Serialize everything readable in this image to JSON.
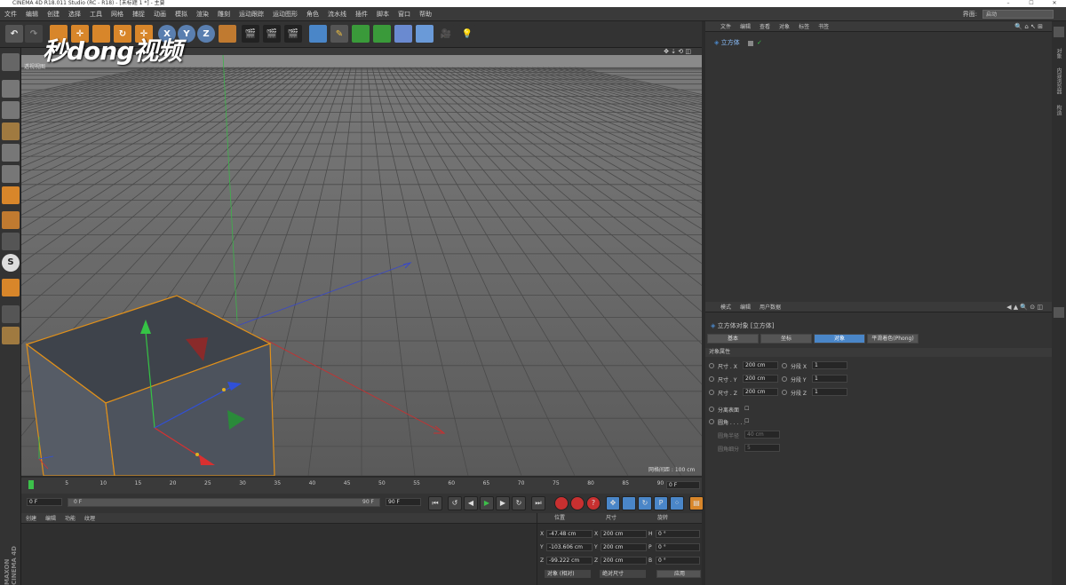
{
  "window": {
    "title": "CINEMA 4D R18.011 Studio (RC - R18) - [未标题 1 *] - 主要"
  },
  "menu": [
    "文件",
    "编辑",
    "创建",
    "选择",
    "工具",
    "网格",
    "捕捉",
    "动画",
    "模拟",
    "渲染",
    "雕刻",
    "运动跟踪",
    "运动图形",
    "角色",
    "流水线",
    "插件",
    "脚本",
    "窗口",
    "帮助"
  ],
  "layout": {
    "label": "界面:",
    "value": "启动"
  },
  "watermark": "秒dong视频",
  "viewport": {
    "label": "透视视图",
    "grid_spacing": "网格间距 : 100 cm"
  },
  "timeline": {
    "ticks": [
      "0",
      "5",
      "10",
      "15",
      "20",
      "25",
      "30",
      "35",
      "40",
      "45",
      "50",
      "55",
      "60",
      "65",
      "70",
      "75",
      "80",
      "85",
      "90"
    ],
    "current_frame": "0 F",
    "start": "0 F",
    "range_start": "0 F",
    "range_end": "90 F",
    "end": "90 F"
  },
  "material_manager": {
    "menu": [
      "创建",
      "编辑",
      "功能",
      "纹理"
    ]
  },
  "coordinates": {
    "headers": [
      "位置",
      "尺寸",
      "旋转"
    ],
    "rows": [
      {
        "axis": "X",
        "pos": "-47.48 cm",
        "size_axis": "X",
        "size": "200 cm",
        "rot_axis": "H",
        "rot": "0 °"
      },
      {
        "axis": "Y",
        "pos": "-103.606 cm",
        "size_axis": "Y",
        "size": "200 cm",
        "rot_axis": "P",
        "rot": "0 °"
      },
      {
        "axis": "Z",
        "pos": "-99.222 cm",
        "size_axis": "Z",
        "size": "200 cm",
        "rot_axis": "B",
        "rot": "0 °"
      }
    ],
    "mode": "对象 (相对)",
    "size_mode": "绝对尺寸",
    "apply": "应用"
  },
  "object_manager": {
    "menu": [
      "文件",
      "编辑",
      "查看",
      "对象",
      "标签",
      "书签"
    ],
    "objects": [
      {
        "name": "立方体"
      }
    ]
  },
  "attribute_manager": {
    "menu": [
      "模式",
      "编辑",
      "用户数据"
    ],
    "object_title": "立方体对象 [立方体]",
    "tabs": [
      "基本",
      "坐标",
      "对象",
      "平滑着色(Phong)"
    ],
    "active_tab": "对象",
    "section": "对象属性",
    "size_rows": [
      {
        "label": "尺寸 . X",
        "value": "200 cm",
        "seg_label": "分段 X",
        "seg": "1"
      },
      {
        "label": "尺寸 . Y",
        "value": "200 cm",
        "seg_label": "分段 Y",
        "seg": "1"
      },
      {
        "label": "尺寸 . Z",
        "value": "200 cm",
        "seg_label": "分段 Z",
        "seg": "1"
      }
    ],
    "separate_surfaces": "分离表面",
    "fillet": "圆角 . . . . .",
    "fillet_radius_label": "圆角半径",
    "fillet_radius": "40 cm",
    "fillet_subdiv_label": "圆角细分",
    "fillet_subdiv": "5"
  },
  "right_tabs": [
    "对象",
    "内容浏览器",
    "构造"
  ],
  "brand": "MAXON CINEMA 4D"
}
